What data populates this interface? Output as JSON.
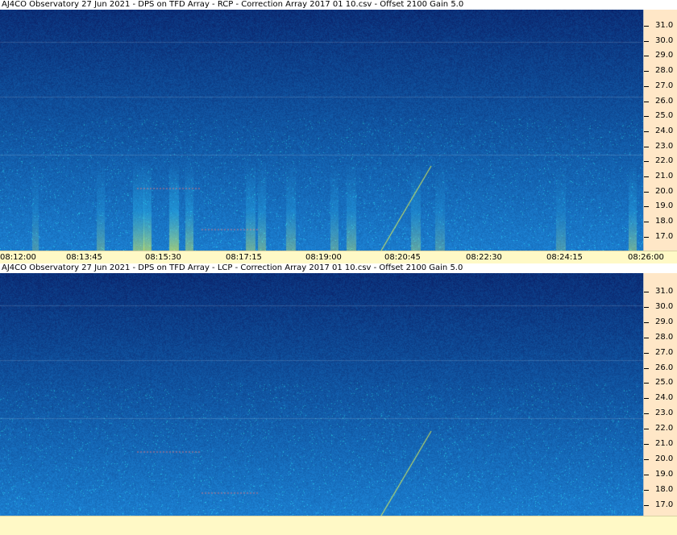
{
  "app": {
    "panels": [
      {
        "title": "AJ4CO Observatory 27 Jun 2021  -  DPS on TFD Array  -  RCP  -  Correction Array 2017 01 10.csv  -  Offset 2100  Gain 5.0",
        "polarization": "RCP",
        "frequency_ticks": [
          "31.0",
          "30.0",
          "29.0",
          "28.0",
          "27.0",
          "26.0",
          "25.0",
          "24.0",
          "23.0",
          "22.0",
          "21.0",
          "20.0",
          "19.0",
          "18.0",
          "17.0"
        ],
        "time_ticks": [
          "08:12:00",
          "08:13:45",
          "08:15:30",
          "08:17:15",
          "08:19:00",
          "08:20:45",
          "08:22:30",
          "08:24:15",
          "08:26:00"
        ]
      },
      {
        "title": "AJ4CO Observatory 27 Jun 2021  -  DPS on TFD Array  -  LCP  -  Correction Array 2017 01 10.csv  -  Offset 2100  Gain 5.0",
        "polarization": "LCP",
        "frequency_ticks": [
          "31.0",
          "30.0",
          "29.0",
          "28.0",
          "27.0",
          "26.0",
          "25.0",
          "24.0",
          "23.0",
          "22.0",
          "21.0",
          "20.0",
          "19.0",
          "18.0",
          "17.0"
        ]
      }
    ]
  },
  "colors": {
    "scale_bg": "#ffe7c7",
    "time_axis_bg": "#fff9c6",
    "sky_deep": "#06186f",
    "sky_mid": "#1d5fe6",
    "sky_low": "#2f86ff",
    "signal_hot": "#f6ff4a",
    "signal_warm": "#34d9ff"
  }
}
